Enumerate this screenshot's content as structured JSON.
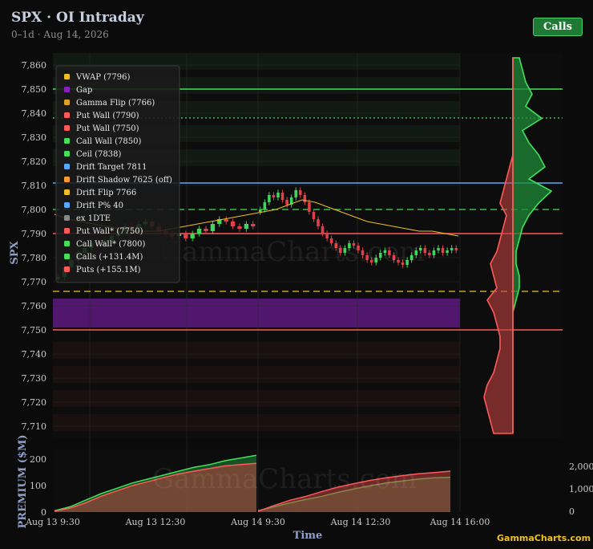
{
  "header": {
    "title": "SPX · OI Intraday",
    "subtitle": "0–1d · Aug 14, 2026",
    "calls_button": "Calls"
  },
  "watermark": "GammaCharts.com",
  "brand": "GammaCharts.com",
  "colors": {
    "background": "#0b0b0b",
    "vwap": "#f0c020",
    "gap": "#8a1fc0",
    "gamma_flip": "#e0a020",
    "put_wall": "#ff5a5a",
    "call_wall": "#44e05a",
    "drift_target": "#5aa8ff",
    "candle_up": "#3dd65a",
    "candle_down": "#e0404a",
    "calls": "#1f8a3a",
    "puts": "#c04040"
  },
  "chart_data": [
    {
      "type": "candlestick",
      "ylabel": "SPX",
      "ylim": [
        7705,
        7865
      ],
      "yticks": [
        7860,
        7850,
        7840,
        7830,
        7820,
        7810,
        7800,
        7790,
        7780,
        7770,
        7760,
        7750,
        7740,
        7730,
        7720,
        7710
      ],
      "ytick_labels": [
        "7,860",
        "7,850",
        "7,840",
        "7,830",
        "7,820",
        "7,810",
        "7,800",
        "7,790",
        "7,780",
        "7,770",
        "7,760",
        "7,750",
        "7,740",
        "7,730",
        "7,720",
        "7,710"
      ],
      "legend_position": "top-left",
      "legend": [
        {
          "label": "VWAP (7796)",
          "color": "#f0c020"
        },
        {
          "label": "Gap",
          "color": "#8a1fc0"
        },
        {
          "label": "Gamma Flip (7766)",
          "color": "#e0a020"
        },
        {
          "label": "Put Wall (7790)",
          "color": "#ff5a5a"
        },
        {
          "label": "Put Wall (7750)",
          "color": "#ff5a5a"
        },
        {
          "label": "Call Wall (7850)",
          "color": "#44e05a"
        },
        {
          "label": "Ceil (7838)",
          "color": "#44e05a"
        },
        {
          "label": "Drift Target 7811",
          "color": "#5aa8ff"
        },
        {
          "label": "Drift Shadow 7625 (off)",
          "color": "#ff9a30"
        },
        {
          "label": "Drift Flip 7766",
          "color": "#f0c020"
        },
        {
          "label": "Drift P% 40",
          "color": "#5aa8ff"
        },
        {
          "label": "ex 1DTE",
          "color": "#888888"
        },
        {
          "label": "Put Wall* (7750)",
          "color": "#ff5a5a"
        },
        {
          "label": "Call Wall* (7800)",
          "color": "#44e05a"
        },
        {
          "label": "Calls (+131.4M)",
          "color": "#44e05a"
        },
        {
          "label": "Puts (+155.1M)",
          "color": "#ff5a5a"
        }
      ],
      "levels": [
        {
          "name": "Call Wall",
          "value": 7850,
          "color": "#44e05a",
          "style": "solid"
        },
        {
          "name": "Ceil",
          "value": 7838,
          "color": "#44e05a",
          "style": "dotted"
        },
        {
          "name": "Drift Target",
          "value": 7811,
          "color": "#5aa8ff",
          "style": "solid"
        },
        {
          "name": "Call Wall*",
          "value": 7800,
          "color": "#44e05a",
          "style": "dashed"
        },
        {
          "name": "Put Wall",
          "value": 7790,
          "color": "#ff5a5a",
          "style": "solid"
        },
        {
          "name": "Gamma Flip",
          "value": 7766,
          "color": "#f0c020",
          "style": "dashed"
        },
        {
          "name": "Put Wall (7750)",
          "value": 7750,
          "color": "#ff5a5a",
          "style": "solid"
        }
      ],
      "gap": [
        7751,
        7763
      ],
      "candles_day1": [
        7772,
        7776,
        7779,
        7782,
        7784,
        7786,
        7785,
        7787,
        7789,
        7791,
        7793,
        7792,
        7794,
        7795,
        7793,
        7791,
        7790,
        7789,
        7790,
        7788,
        7790,
        7792,
        7791,
        7794,
        7796,
        7795,
        7793,
        7792,
        7794,
        7793
      ],
      "candles_day2": [
        7800,
        7803,
        7806,
        7805,
        7807,
        7804,
        7802,
        7805,
        7808,
        7806,
        7803,
        7799,
        7796,
        7793,
        7790,
        7788,
        7786,
        7784,
        7782,
        7784,
        7786,
        7785,
        7783,
        7781,
        7779,
        7778,
        7780,
        7782,
        7783,
        7781,
        7779,
        7778,
        7777,
        7779,
        7781,
        7783,
        7784,
        7782,
        7781,
        7783,
        7784,
        7782,
        7783,
        7784,
        7783
      ],
      "vwap": [
        7798,
        7796,
        7795,
        7794,
        7793,
        7792,
        7791,
        7791,
        7791,
        7792,
        7793,
        7794,
        7795,
        7796,
        7797,
        7798,
        7799,
        7800,
        7802,
        7804,
        7803,
        7801,
        7799,
        7797,
        7795,
        7794,
        7793,
        7792,
        7791,
        7791,
        7790,
        7789
      ],
      "profile": {
        "calls": [
          2,
          3,
          4,
          6,
          4,
          9,
          3,
          5,
          8,
          10,
          5,
          12,
          8,
          5,
          3,
          2,
          1,
          1,
          2,
          2,
          1,
          0,
          0,
          0,
          0,
          0,
          0,
          0,
          0,
          0,
          0,
          0
        ],
        "puts": [
          0,
          0,
          0,
          0,
          0,
          0,
          0,
          0,
          0,
          1,
          2,
          3,
          4,
          2,
          3,
          4,
          5,
          7,
          6,
          5,
          8,
          6,
          5,
          4,
          4,
          5,
          6,
          8,
          9,
          8,
          7,
          6
        ]
      }
    },
    {
      "type": "area",
      "ylabel": "PREMIUM ($M)",
      "xlabel": "Time",
      "ylim": [
        0,
        225
      ],
      "yticks": [
        0,
        100,
        200
      ],
      "y2ticks": [
        "0",
        "1,000",
        "2,000"
      ],
      "xtick_labels": [
        "Aug 13 9:30",
        "Aug 13 12:30",
        "Aug 14 9:30",
        "Aug 14 12:30",
        "Aug 14 16:00"
      ],
      "series": [
        {
          "name": "Calls (+131.4M)",
          "day1": [
            5,
            20,
            45,
            70,
            90,
            110,
            125,
            140,
            155,
            170,
            180,
            195,
            205,
            215
          ],
          "day2": [
            5,
            20,
            35,
            48,
            60,
            75,
            88,
            100,
            110,
            118,
            125,
            130,
            132
          ]
        },
        {
          "name": "Puts (+155.1M)",
          "day1": [
            3,
            15,
            35,
            60,
            80,
            100,
            115,
            130,
            145,
            155,
            165,
            175,
            180,
            185
          ],
          "day2": [
            3,
            25,
            45,
            60,
            78,
            95,
            108,
            120,
            130,
            138,
            145,
            150,
            155
          ]
        }
      ]
    }
  ]
}
